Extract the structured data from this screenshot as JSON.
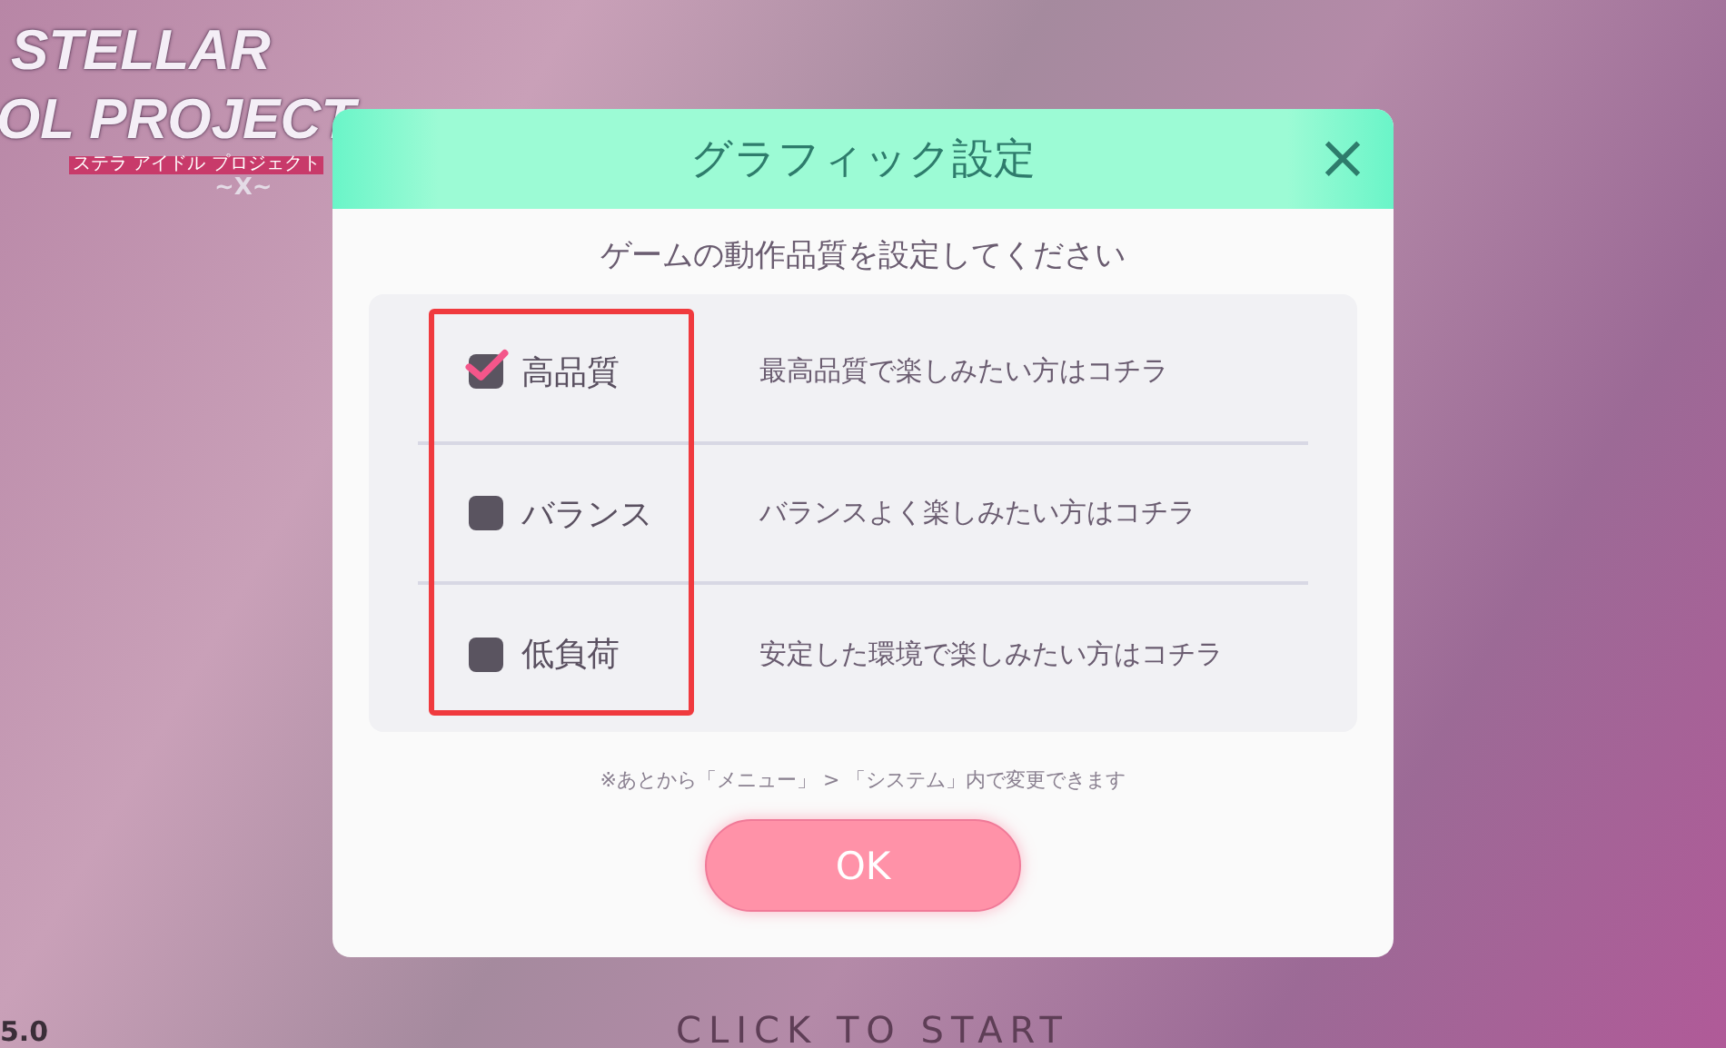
{
  "background": {
    "logo": {
      "line_1": "STELLAR",
      "line_2": "OL PROJECT",
      "subtitle": "ステラ アイドル プロジェクト",
      "mark": "~X~"
    },
    "version": "5.0",
    "prompt": "CLICK TO START"
  },
  "dialog": {
    "title": "グラフィック設定",
    "close": "×",
    "instruction": "ゲームの動作品質を設定してください",
    "options": [
      {
        "label": "高品質",
        "description": "最高品質で楽しみたい方はコチラ",
        "checked": true
      },
      {
        "label": "バランス",
        "description": "バランスよく楽しみたい方はコチラ",
        "checked": false
      },
      {
        "label": "低負荷",
        "description": "安定した環境で楽しみたい方はコチラ",
        "checked": false
      }
    ],
    "note": "※あとから「メニュー」 > 「システム」内で変更できます",
    "ok_button": "OK"
  }
}
